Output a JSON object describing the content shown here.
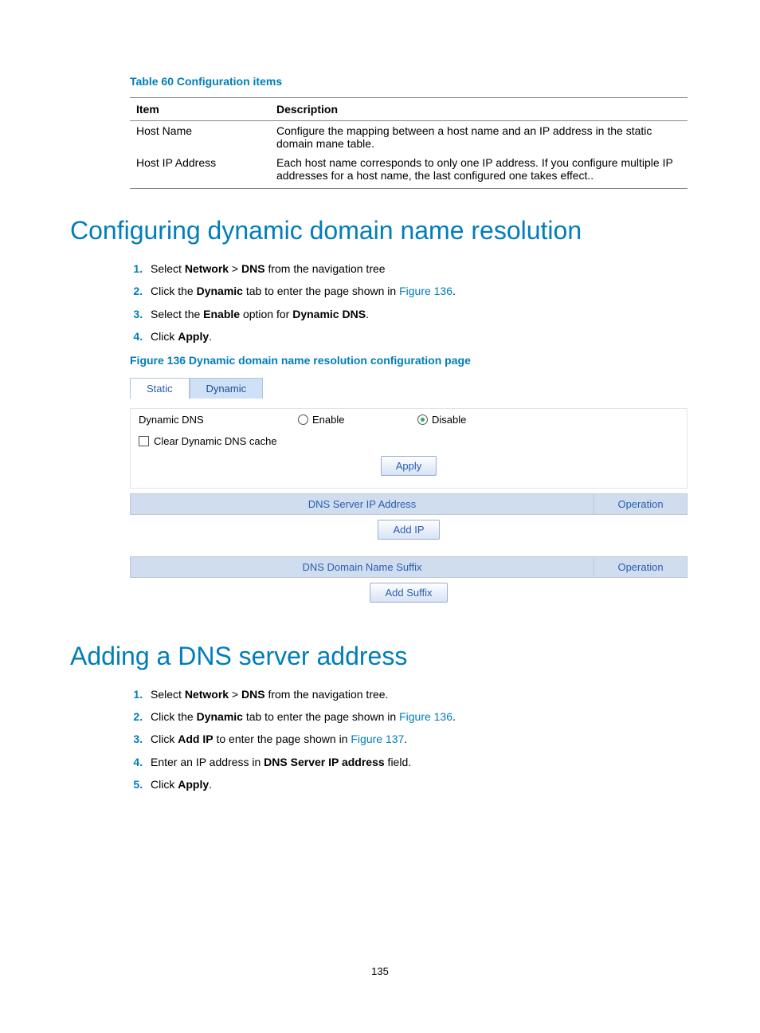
{
  "table60": {
    "title": "Table 60 Configuration items",
    "headers": {
      "item": "Item",
      "description": "Description"
    },
    "rows": [
      {
        "item": "Host Name",
        "desc": "Configure the mapping between a host name and an IP address in the static domain mane table."
      },
      {
        "item": "Host IP Address",
        "desc": "Each host name corresponds to only one IP address. If you configure multiple IP addresses for a host name, the last configured one takes effect.."
      }
    ]
  },
  "section1": {
    "heading": "Configuring dynamic domain name resolution",
    "steps": {
      "s1_pre": "Select ",
      "s1_b1": "Network",
      "s1_gt": " > ",
      "s1_b2": "DNS",
      "s1_post": " from the navigation tree",
      "s2_pre": "Click the ",
      "s2_b": "Dynamic",
      "s2_mid": " tab to enter the page shown in ",
      "s2_link": "Figure 136",
      "s2_end": ".",
      "s3_pre": "Select the ",
      "s3_b1": "Enable",
      "s3_mid": " option for ",
      "s3_b2": "Dynamic DNS",
      "s3_end": ".",
      "s4_pre": "Click ",
      "s4_b": "Apply",
      "s4_end": "."
    }
  },
  "figure136": {
    "title": "Figure 136 Dynamic domain name resolution configuration page",
    "tabs": {
      "static": "Static",
      "dynamic": "Dynamic"
    },
    "labels": {
      "dynamic_dns": "Dynamic DNS",
      "enable": "Enable",
      "disable": "Disable",
      "clear_cache": "Clear Dynamic DNS cache",
      "apply": "Apply",
      "dns_server_ip": "DNS Server IP Address",
      "operation": "Operation",
      "add_ip": "Add IP",
      "dns_domain_suffix": "DNS Domain Name Suffix",
      "add_suffix": "Add Suffix"
    }
  },
  "section2": {
    "heading": "Adding a DNS server address",
    "steps": {
      "s1_pre": "Select ",
      "s1_b1": "Network",
      "s1_gt": " > ",
      "s1_b2": "DNS",
      "s1_post": " from the navigation tree.",
      "s2_pre": "Click the ",
      "s2_b": "Dynamic",
      "s2_mid": " tab to enter the page shown in ",
      "s2_link": "Figure 136",
      "s2_end": ".",
      "s3_pre": "Click ",
      "s3_b": "Add IP",
      "s3_mid": " to enter the page shown in ",
      "s3_link": "Figure 137",
      "s3_end": ".",
      "s4_pre": "Enter an IP address in ",
      "s4_b": "DNS Server IP address",
      "s4_end": " field.",
      "s5_pre": "Click ",
      "s5_b": "Apply",
      "s5_end": "."
    }
  },
  "page_number": "135"
}
